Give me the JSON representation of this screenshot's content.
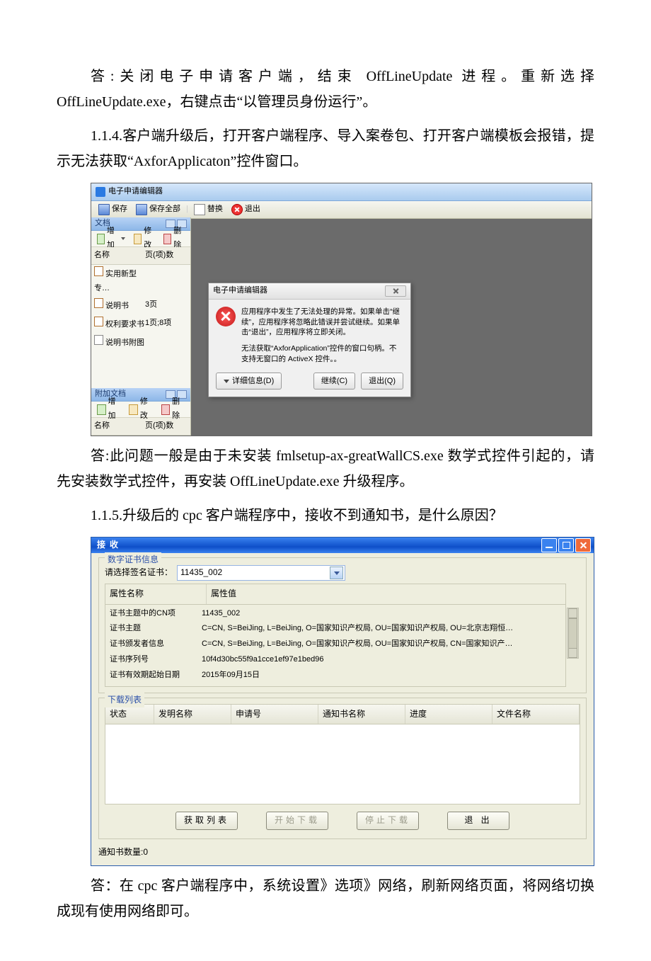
{
  "para1": "答:关闭电子申请客户端，结束 OffLineUpdate 进程。重新选择 OffLineUpdate.exe，右键点击“以管理员身份运行”。",
  "para2": "1.1.4.客户端升级后，打开客户端程序、导入案卷包、打开客户端模板会报错，提示无法获取“AxforApplicaton”控件窗口。",
  "para3": "答:此问题一般是由于未安装 fmlsetup-ax-greatWallCS.exe 数学式控件引起的，请先安装数学式控件，再安装 OffLineUpdate.exe 升级程序。",
  "para4": "1.1.5.升级后的 cpc 客户端程序中，接收不到通知书，是什么原因？",
  "para5": "答：在 cpc 客户端程序中，系统设置》选项》网络，刷新网络页面，将网络切换成现有使用网络即可。",
  "shot1": {
    "title": "电子申请编辑器",
    "toolbar": {
      "save": "保存",
      "saveAll": "保存全部",
      "replace": "替换",
      "exit": "退出"
    },
    "panel1": {
      "title": "文档",
      "add": "增加",
      "edit": "修改",
      "del": "删除",
      "colName": "名称",
      "colPages": "页(项)数",
      "rows": [
        {
          "name": "实用新型专…",
          "pages": ""
        },
        {
          "name": "说明书",
          "pages": "3页"
        },
        {
          "name": "权利要求书",
          "pages": "1页;8项"
        },
        {
          "name": "说明书附图",
          "pages": ""
        }
      ]
    },
    "panel2": {
      "title": "附加文档",
      "add": "增加",
      "edit": "修改",
      "del": "删除",
      "colName": "名称",
      "colPages": "页(项)数"
    },
    "dialog": {
      "title": "电子申请编辑器",
      "msg1": "应用程序中发生了无法处理的异常。如果单击“继续”，应用程序将忽略此错误并尝试继续。如果单击“退出”，应用程序将立即关闭。",
      "msg2": "无法获取“AxforApplication”控件的窗口句柄。不支持无窗口的 ActiveX 控件。。",
      "details": "详细信息(D)",
      "cont": "继续(C)",
      "quit": "退出(Q)"
    }
  },
  "shot2": {
    "title": "接收",
    "group1": {
      "title": "数字证书信息",
      "label": "请选择签名证书：",
      "selected": "11435_002",
      "header_k": "属性名称",
      "header_v": "属性值",
      "attrs": [
        {
          "k": "证书主题中的CN项",
          "v": "11435_002"
        },
        {
          "k": "证书主题",
          "v": "C=CN, S=BeiJing, L=BeiJing, O=国家知识产权局, OU=国家知识产权局, OU=北京志翔恒…"
        },
        {
          "k": "证书颁发者信息",
          "v": "C=CN, S=BeiJing, L=BeiJing, O=国家知识产权局, OU=国家知识产权局, CN=国家知识产…"
        },
        {
          "k": "证书序列号",
          "v": "10f4d30bc55f9a1cce1ef97e1bed96"
        },
        {
          "k": "证书有效期起始日期",
          "v": "2015年09月15日"
        }
      ]
    },
    "group2": {
      "title": "下载列表",
      "cols": {
        "c1": "状态",
        "c2": "发明名称",
        "c3": "申请号",
        "c4": "通知书名称",
        "c5": "进度",
        "c6": "文件名称"
      }
    },
    "buttons": {
      "fetch": "获取列表",
      "start": "开始下载",
      "stop": "停止下载",
      "exit": "退 出"
    },
    "status": "通知书数量:0"
  }
}
